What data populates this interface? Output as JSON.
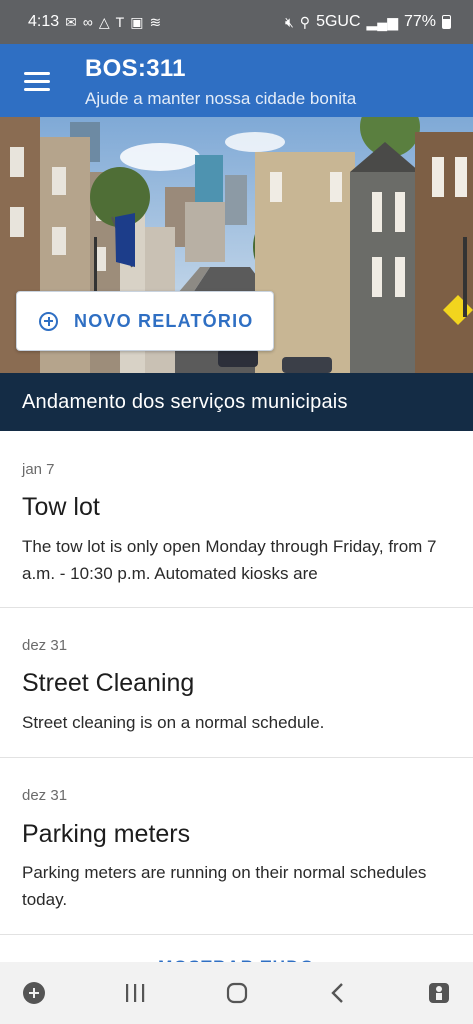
{
  "status_bar": {
    "time": "4:13",
    "network": "5GUC",
    "battery": "77%"
  },
  "app_bar": {
    "title": "BOS:311",
    "subtitle": "Ajude a manter nossa cidade bonita"
  },
  "hero": {
    "new_report_label": "NOVO RELATÓRIO"
  },
  "section": {
    "title": "Andamento dos serviços municipais"
  },
  "cards": [
    {
      "date": "jan 7",
      "title": "Tow lot",
      "body": "The tow lot is only open Monday through Friday, from 7 a.m. - 10:30 p.m. Automated kiosks are"
    },
    {
      "date": "dez 31",
      "title": "Street Cleaning",
      "body": "Street cleaning is on a normal schedule."
    },
    {
      "date": "dez 31",
      "title": "Parking meters",
      "body": "Parking meters are running on their normal schedules today."
    }
  ],
  "show_all_label": "MOSTRAR TUDO",
  "colors": {
    "brand": "#2f6fc3",
    "section_header": "#142c45"
  },
  "icons": [
    "menu-icon",
    "plus-circle-icon",
    "recent-apps-icon",
    "home-icon",
    "back-icon"
  ]
}
